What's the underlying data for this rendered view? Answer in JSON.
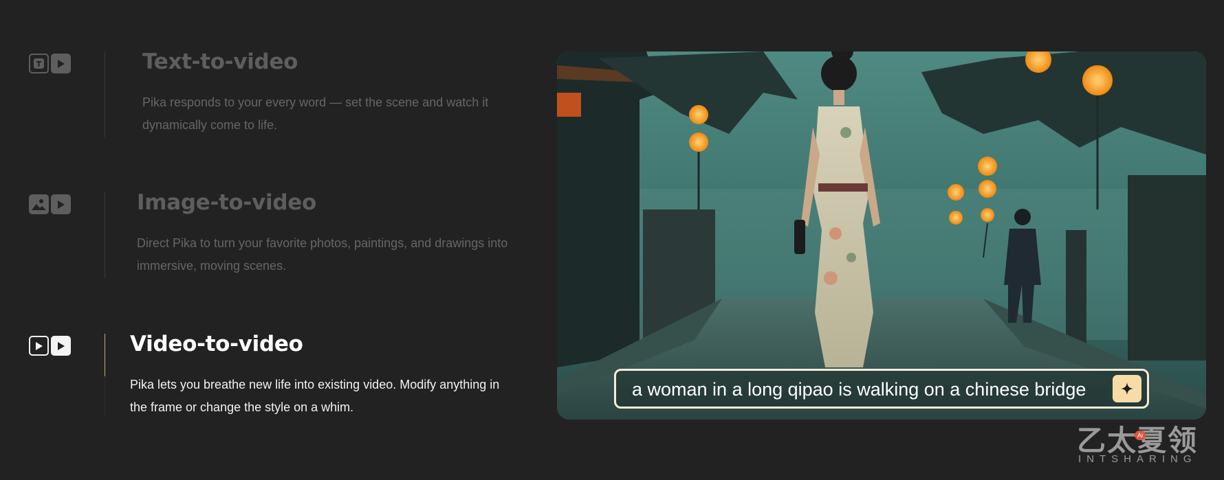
{
  "features": [
    {
      "title": "Text-to-video",
      "description": "Pika responds to your every word — set the scene and watch it dynamically come to life.",
      "icon_left": "text-T-icon",
      "icon_right": "play-icon",
      "active": false
    },
    {
      "title": "Image-to-video",
      "description": "Direct Pika to turn your favorite photos, paintings, and drawings into immersive, moving scenes.",
      "icon_left": "image-icon",
      "icon_right": "play-icon",
      "active": false
    },
    {
      "title": "Video-to-video",
      "description": "Pika lets you breathe new life into existing video. Modify anything in the frame or change the style on a whim.",
      "icon_left": "video-play-icon",
      "icon_right": "play-icon",
      "active": true
    }
  ],
  "video": {
    "prompt": "a woman in a long qipao is walking on a chinese bridge",
    "submit_icon": "sparkle-icon"
  },
  "watermark": {
    "logo_text": "乙太夏领",
    "badge_text": "Ai",
    "subtitle": "INTSHARING"
  },
  "colors": {
    "background": "#222222",
    "inactive_text": "#5e5e5e",
    "active_text": "#ffffff",
    "active_divider": "#c9a96b",
    "prompt_border": "#f5ecd9",
    "sparkle_button": "#f7dca8",
    "lantern": "#f59a1c"
  }
}
